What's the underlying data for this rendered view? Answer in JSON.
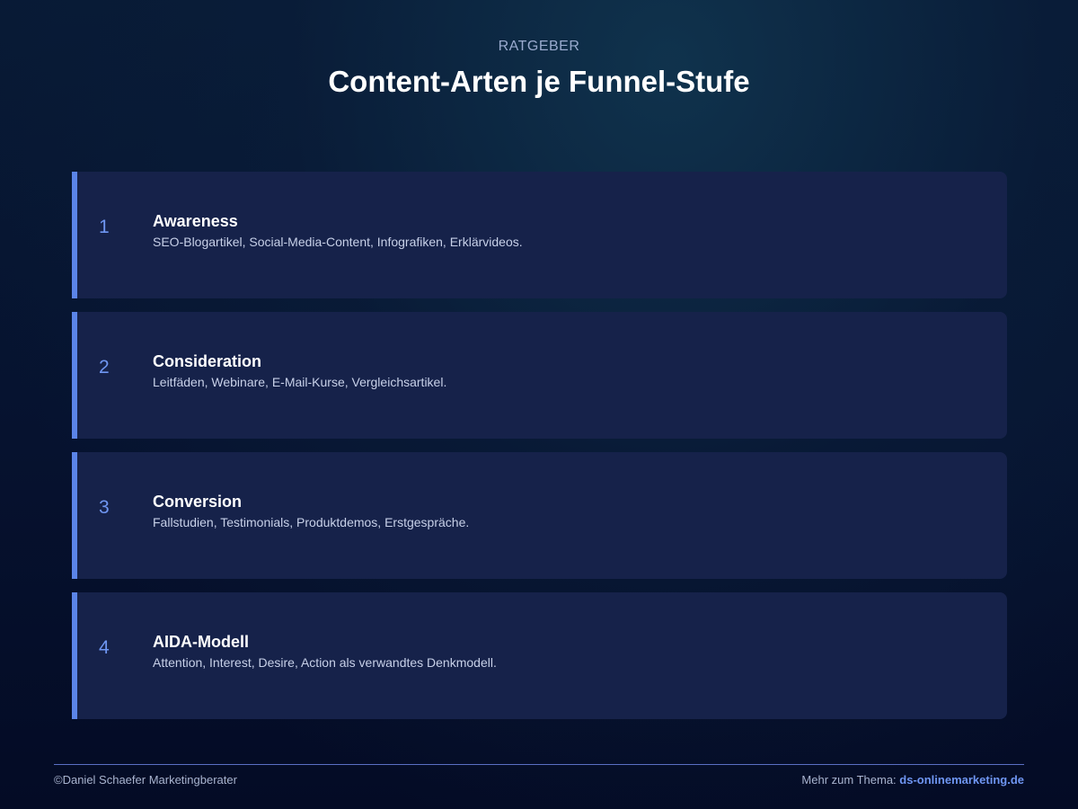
{
  "header": {
    "eyebrow": "RATGEBER",
    "title": "Content-Arten je Funnel-Stufe"
  },
  "stages": [
    {
      "number": "1",
      "title": "Awareness",
      "text": "SEO-Blogartikel, Social-Media-Content, Infografiken, Erklärvideos."
    },
    {
      "number": "2",
      "title": "Consideration",
      "text": "Leitfäden, Webinare, E-Mail-Kurse, Vergleichsartikel."
    },
    {
      "number": "3",
      "title": "Conversion",
      "text": "Fallstudien, Testimonials, Produktdemos, Erstgespräche."
    },
    {
      "number": "4",
      "title": "AIDA-Modell",
      "text": "Attention, Interest, Desire, Action als verwandtes Denkmodell."
    }
  ],
  "footer": {
    "copyright": "©Daniel Schaefer Marketingberater",
    "more_label": "Mehr zum Thema:",
    "link_text": "ds-onlinemarketing.de"
  },
  "colors": {
    "accent": "#5b84e8",
    "card_background": "#16224a",
    "page_background": "#06122f"
  }
}
